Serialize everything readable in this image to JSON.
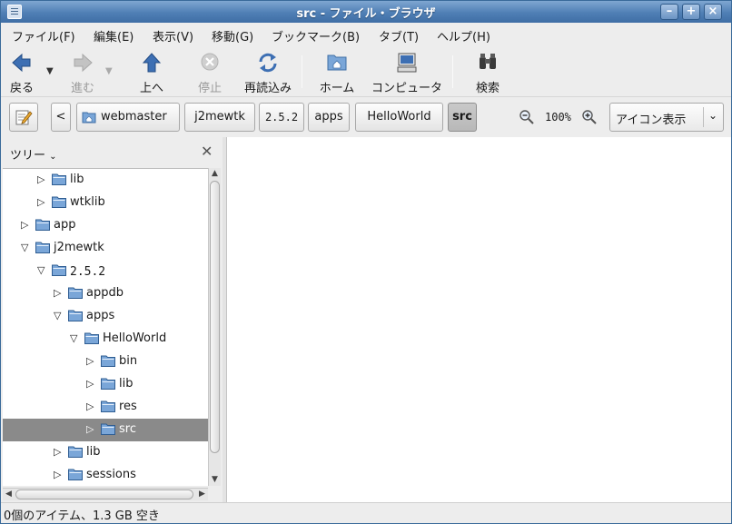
{
  "window": {
    "title": "src - ファイル・ブラウザ"
  },
  "menu": [
    "ファイル(F)",
    "編集(E)",
    "表示(V)",
    "移動(G)",
    "ブックマーク(B)",
    "タブ(T)",
    "ヘルプ(H)"
  ],
  "toolbar": {
    "back": "戻る",
    "forward": "進む",
    "up": "上へ",
    "stop": "停止",
    "reload": "再読込み",
    "home": "ホーム",
    "computer": "コンピュータ",
    "search": "検索"
  },
  "location": {
    "path": [
      "webmaster",
      "j2mewtk",
      "2.5.2",
      "apps",
      "HelloWorld",
      "src"
    ],
    "zoom": "100%",
    "view_mode": "アイコン表示"
  },
  "sidepane": {
    "title": "ツリー",
    "tree": [
      {
        "label": "lib",
        "expanded": false,
        "depth": 2,
        "selected": false
      },
      {
        "label": "wtklib",
        "expanded": false,
        "depth": 2,
        "selected": false
      },
      {
        "label": "app",
        "expanded": false,
        "depth": 1,
        "selected": false
      },
      {
        "label": "j2mewtk",
        "expanded": true,
        "depth": 1,
        "selected": false
      },
      {
        "label": "2.5.2",
        "expanded": true,
        "depth": 2,
        "selected": false
      },
      {
        "label": "appdb",
        "expanded": false,
        "depth": 3,
        "selected": false
      },
      {
        "label": "apps",
        "expanded": true,
        "depth": 3,
        "selected": false
      },
      {
        "label": "HelloWorld",
        "expanded": true,
        "depth": 4,
        "selected": false
      },
      {
        "label": "bin",
        "expanded": false,
        "depth": 5,
        "selected": false
      },
      {
        "label": "lib",
        "expanded": false,
        "depth": 5,
        "selected": false
      },
      {
        "label": "res",
        "expanded": false,
        "depth": 5,
        "selected": false
      },
      {
        "label": "src",
        "expanded": false,
        "depth": 5,
        "selected": true
      },
      {
        "label": "lib",
        "expanded": false,
        "depth": 3,
        "selected": false
      },
      {
        "label": "sessions",
        "expanded": false,
        "depth": 3,
        "selected": false
      }
    ]
  },
  "status": {
    "text": "0個のアイテム、1.3 GB 空き"
  },
  "colors": {
    "titlebar": "#4f7fb5",
    "selection": "#8a8a8a",
    "folder": "#7aa6d8"
  }
}
